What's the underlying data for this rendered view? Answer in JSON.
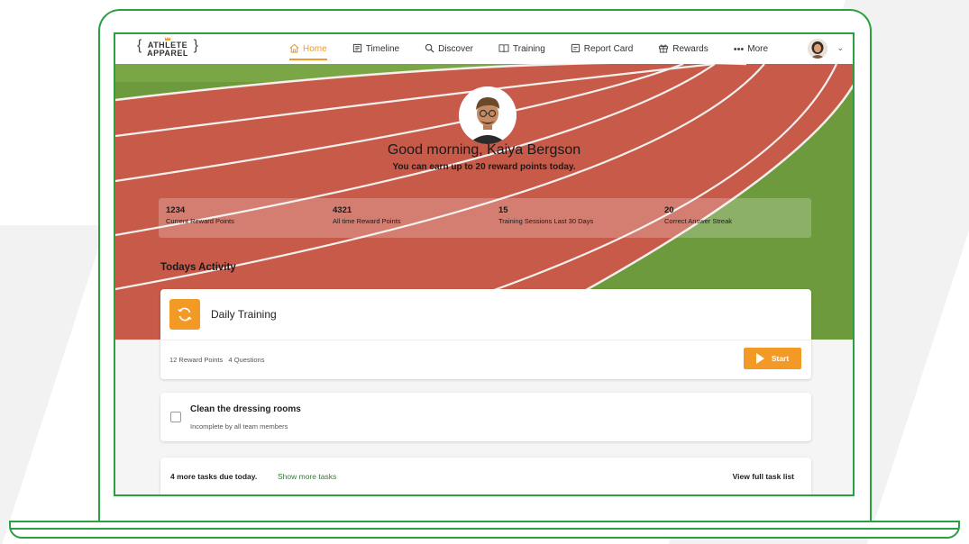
{
  "brand": {
    "line1": "ATHLETE",
    "line2": "APPAREL",
    "accent": "#f29a25"
  },
  "nav": {
    "items": [
      {
        "label": "Home",
        "icon": "home-icon",
        "active": true
      },
      {
        "label": "Timeline",
        "icon": "timeline-icon"
      },
      {
        "label": "Discover",
        "icon": "search-icon"
      },
      {
        "label": "Training",
        "icon": "book-icon"
      },
      {
        "label": "Report Card",
        "icon": "report-icon"
      },
      {
        "label": "Rewards",
        "icon": "gift-icon"
      },
      {
        "label": "More",
        "icon": "more-dots-icon"
      }
    ]
  },
  "hero": {
    "greeting": "Good morning, Kaiya Bergson",
    "subline": "You can earn up to 20 reward points today."
  },
  "stats": [
    {
      "value": "1234",
      "label": "Current Reward Points"
    },
    {
      "value": "4321",
      "label": "All time Reward Points"
    },
    {
      "value": "15",
      "label": "Training Sessions Last 30 Days"
    },
    {
      "value": "20",
      "label": "Correct Answer Streak"
    }
  ],
  "activity": {
    "title": "Todays Activity",
    "daily": {
      "title": "Daily Training",
      "meta": "12 Reward Points   4 Questions",
      "start_label": "Start"
    },
    "task": {
      "title": "Clean the dressing rooms",
      "subtitle": "Incomplete by all team members"
    },
    "footer": {
      "due": "4 more tasks due today.",
      "show_more": "Show more tasks",
      "view_all": "View full task list"
    }
  },
  "colors": {
    "frame": "#2aa040",
    "accent": "#f29a25",
    "link": "#2e7d32",
    "track": "#c85a4a",
    "grass": "#6e9a3e"
  }
}
